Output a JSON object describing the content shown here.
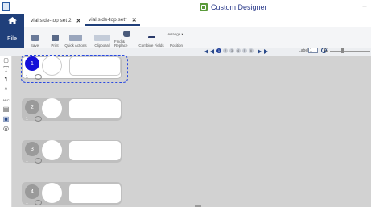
{
  "window": {
    "title": "Custom Designer",
    "minimize_glyph": "–"
  },
  "tabs": [
    {
      "label": "vial side-top set 2",
      "close": "✕"
    },
    {
      "label": "vial side-top set*",
      "close": "✕"
    }
  ],
  "ribbon": {
    "file": "File",
    "buttons": [
      {
        "label": "Save",
        "icon": "save-icon"
      },
      {
        "label": "Print",
        "icon": "print-icon"
      },
      {
        "label": "Quick Actions",
        "icon": "quick-actions-icon"
      },
      {
        "label": "Clipboard",
        "icon": "clipboard-icon"
      },
      {
        "label": "Find & Replace",
        "icon": "binoculars-icon"
      },
      {
        "label": "Combine Fields",
        "icon": "combine-icon"
      },
      {
        "label": "Arrange ▾",
        "icon": "arrange-icon"
      },
      {
        "label": "Position",
        "icon": "position-icon"
      }
    ]
  },
  "toolbar": {
    "pages": [
      "1",
      "2",
      "3",
      "4",
      "5",
      "6"
    ],
    "active_page": "1",
    "label_text": "Label:",
    "label_value": "1"
  },
  "labels": [
    {
      "number": "1",
      "qty": "1",
      "active": true
    },
    {
      "number": "2",
      "qty": "1",
      "active": false
    },
    {
      "number": "3",
      "qty": "1",
      "active": false
    },
    {
      "number": "4",
      "qty": "1",
      "active": false
    }
  ],
  "left_tools": [
    {
      "name": "select-tool",
      "glyph": "▢"
    },
    {
      "name": "text-tool",
      "glyph": "T"
    },
    {
      "name": "rich-text-tool",
      "glyph": "¶"
    },
    {
      "name": "vertical-text-tool",
      "glyph": "ᴬ"
    },
    {
      "name": "barcode-tool",
      "glyph": "ABC"
    },
    {
      "name": "table-tool",
      "glyph": "▤"
    },
    {
      "name": "image-tool",
      "glyph": "▣"
    },
    {
      "name": "shape-tool",
      "glyph": "◎"
    }
  ]
}
